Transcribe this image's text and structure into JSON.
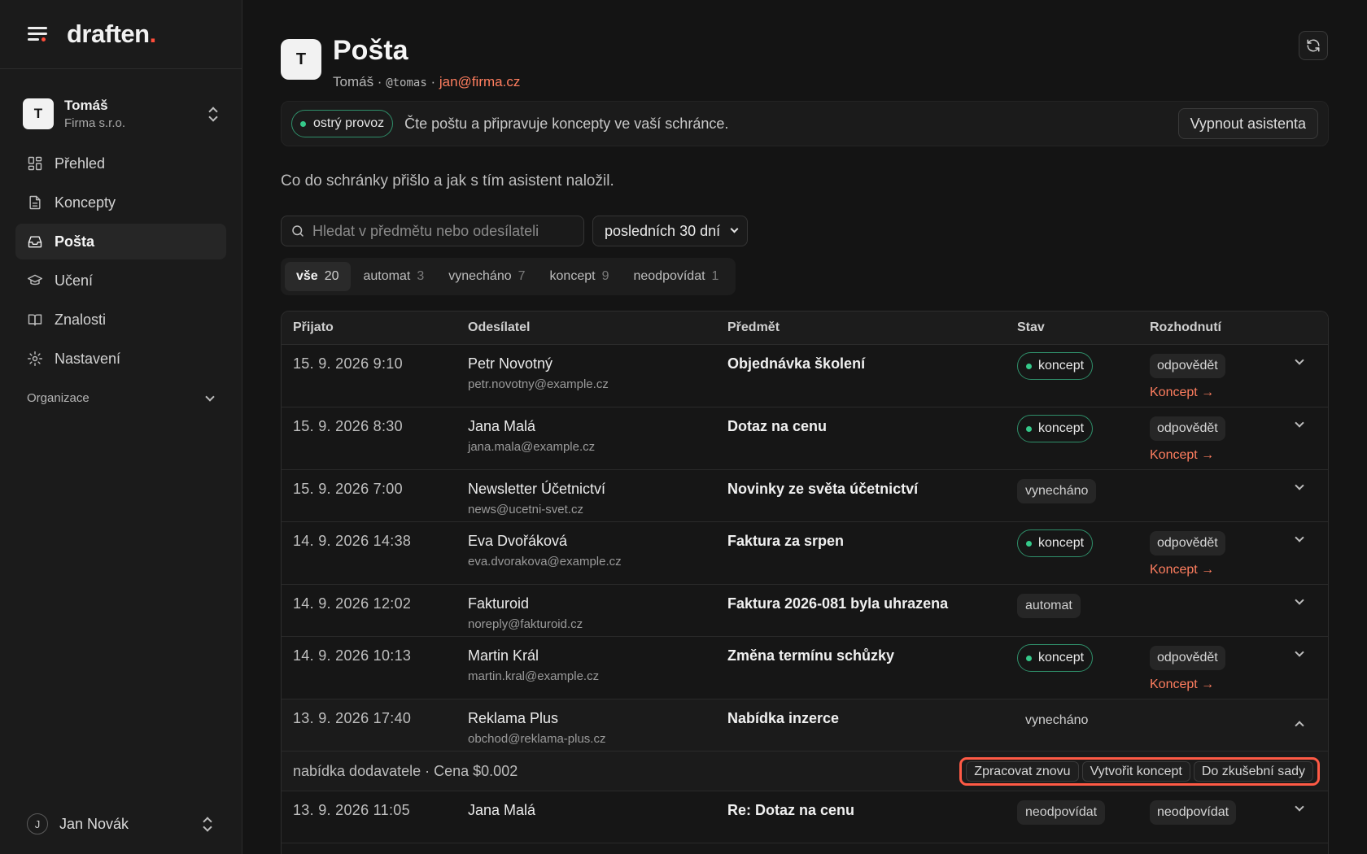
{
  "app": {
    "brand_name": "draften",
    "brand_dot": ".",
    "accent_color": "#ff4d3a"
  },
  "account": {
    "initial": "T",
    "name": "Tomáš",
    "org": "Firma s.r.o."
  },
  "nav": [
    {
      "label": "Přehled",
      "icon": "dashboard-icon"
    },
    {
      "label": "Koncepty",
      "icon": "document-icon"
    },
    {
      "label": "Pošta",
      "icon": "inbox-icon",
      "active": true
    },
    {
      "label": "Učení",
      "icon": "graduation-cap-icon"
    },
    {
      "label": "Znalosti",
      "icon": "book-icon"
    },
    {
      "label": "Nastavení",
      "icon": "gear-icon"
    }
  ],
  "org_section": {
    "label": "Organizace"
  },
  "user": {
    "initial": "J",
    "name": "Jan Novák"
  },
  "page": {
    "avatar_initial": "T",
    "title": "Pošta",
    "owner": "Tomáš",
    "handle": "@tomas",
    "email": "jan@firma.cz",
    "separator": " · "
  },
  "banner": {
    "status": "ostrý provoz",
    "text": "Čte poštu a připravuje koncepty ve vaší schránce.",
    "button": "Vypnout asistenta"
  },
  "intro": "Co do schránky přišlo a jak s tím asistent naložil.",
  "search": {
    "placeholder": "Hledat v předmětu nebo odesílateli",
    "value": ""
  },
  "period": {
    "selected": "posledních 30 dní"
  },
  "filters": [
    {
      "label": "vše",
      "count": "20",
      "active": true
    },
    {
      "label": "automat",
      "count": "3"
    },
    {
      "label": "vynecháno",
      "count": "7"
    },
    {
      "label": "koncept",
      "count": "9"
    },
    {
      "label": "neodpovídat",
      "count": "1"
    }
  ],
  "table": {
    "headers": {
      "received": "Přijato",
      "sender": "Odesílatel",
      "subject": "Předmět",
      "status": "Stav",
      "decision": "Rozhodnutí"
    },
    "rows": [
      {
        "date": "15. 9. 2026 9:10",
        "sender": "Petr Novotný",
        "email": "petr.novotny@example.cz",
        "subject": "Objednávka školení",
        "status": "koncept",
        "status_style": "draft",
        "decision": "odpovědět",
        "link": "Koncept →"
      },
      {
        "date": "15. 9. 2026 8:30",
        "sender": "Jana Malá",
        "email": "jana.mala@example.cz",
        "subject": "Dotaz na cenu",
        "status": "koncept",
        "status_style": "draft",
        "decision": "odpovědět",
        "link": "Koncept →"
      },
      {
        "date": "15. 9. 2026 7:00",
        "sender": "Newsletter Účetnictví",
        "email": "news@ucetni-svet.cz",
        "subject": "Novinky ze světa účetnictví",
        "status": "vynecháno",
        "status_style": "gray"
      },
      {
        "date": "14. 9. 2026 14:38",
        "sender": "Eva Dvořáková",
        "email": "eva.dvorakova@example.cz",
        "subject": "Faktura za srpen",
        "status": "koncept",
        "status_style": "draft",
        "decision": "odpovědět",
        "link": "Koncept →"
      },
      {
        "date": "14. 9. 2026 12:02",
        "sender": "Fakturoid",
        "email": "noreply@fakturoid.cz",
        "subject": "Faktura 2026-081 byla uhrazena",
        "status": "automat",
        "status_style": "gray"
      },
      {
        "date": "14. 9. 2026 10:13",
        "sender": "Martin Král",
        "email": "martin.kral@example.cz",
        "subject": "Změna termínu schůzky",
        "status": "koncept",
        "status_style": "draft",
        "decision": "odpovědět",
        "link": "Koncept →"
      },
      {
        "date": "13. 9. 2026 17:40",
        "sender": "Reklama Plus",
        "email": "obchod@reklama-plus.cz",
        "subject": "Nabídka inzerce",
        "status": "vynecháno",
        "status_style": "plain",
        "expanded": true,
        "detail": "nabídka dodavatele · Cena $0.002",
        "actions": [
          "Zpracovat znovu",
          "Vytvořit koncept",
          "Do zkušební sady"
        ]
      },
      {
        "date": "13. 9. 2026 11:05",
        "sender": "Jana Malá",
        "email": "",
        "subject": "Re: Dotaz na cenu",
        "status": "neodpovídat",
        "status_style": "gray",
        "decision": "neodpovídat"
      }
    ]
  }
}
